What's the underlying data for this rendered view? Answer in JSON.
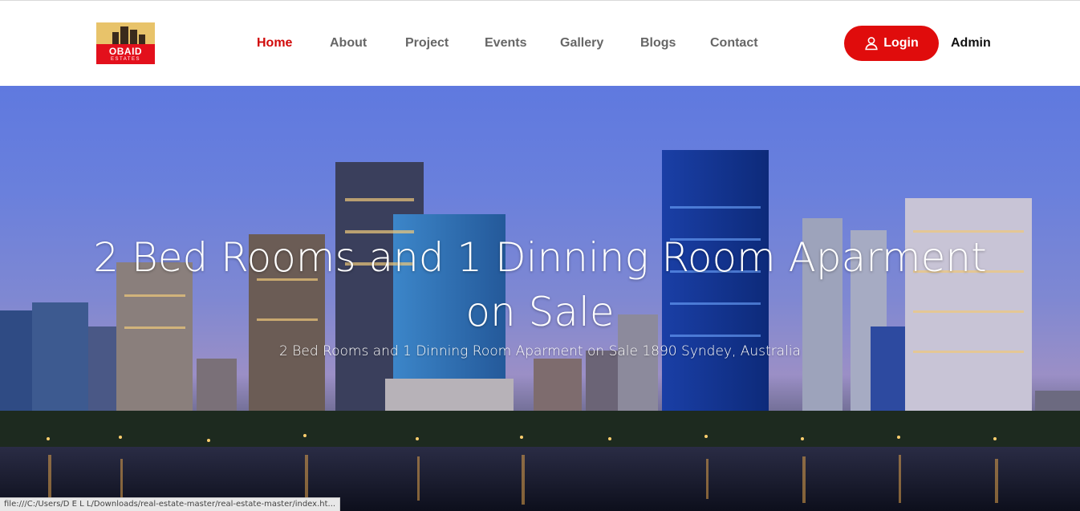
{
  "brand": {
    "line1": "OBAID",
    "line2": "ESTATES",
    "color": "#e3101c"
  },
  "nav": {
    "items": [
      {
        "label": "Home",
        "active": true
      },
      {
        "label": "About",
        "active": false
      },
      {
        "label": "Project",
        "active": false
      },
      {
        "label": "Events",
        "active": false
      },
      {
        "label": "Gallery",
        "active": false
      },
      {
        "label": "Blogs",
        "active": false
      },
      {
        "label": "Contact",
        "active": false
      }
    ],
    "active_color": "#d10a0a"
  },
  "actions": {
    "login_label": "Login",
    "login_icon": "user-icon",
    "admin_label": "Admin",
    "accent": "#e00c0c"
  },
  "hero": {
    "title": "2 Bed Rooms and 1 Dinning Room Aparment on Sale",
    "subtitle": "2 Bed Rooms and 1 Dinning Room Aparment on Sale 1890 Syndey, Australia"
  },
  "status": {
    "url": "file:///C:/Users/D E L L/Downloads/real-estate-master/real-estate-master/index.ht..."
  }
}
